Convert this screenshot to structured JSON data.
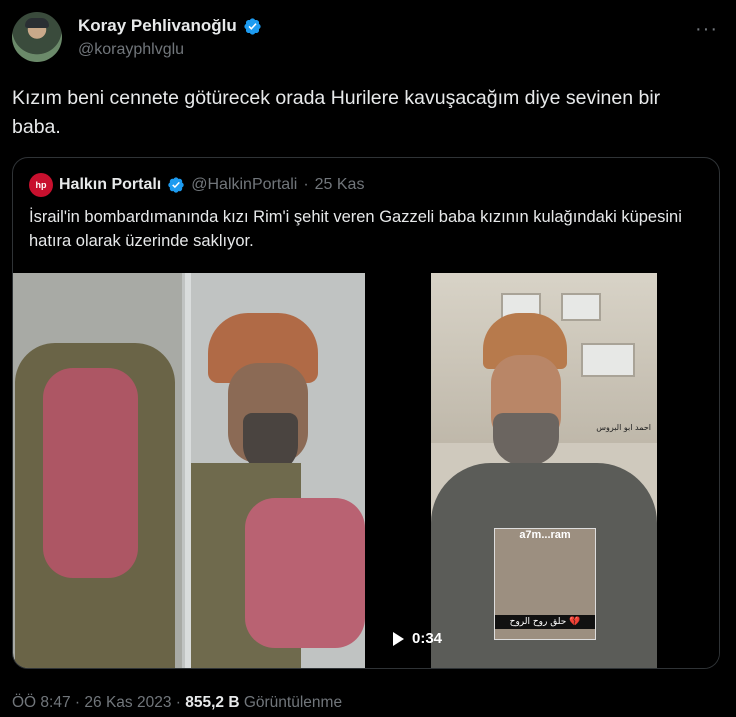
{
  "author": {
    "name": "Koray Pehlivanoğlu",
    "handle": "@korayphlvglu",
    "more_label": "···"
  },
  "tweet": {
    "text": "Kızım beni cennete götürecek orada Hurilere kavuşacağım diye sevinen bir baba."
  },
  "quote": {
    "logo_text": "hp",
    "name": "Halkın Portalı",
    "handle": "@HalkinPortali",
    "separator": "·",
    "date": "25 Kas",
    "text": "İsrail'in bombardımanında kızı Rim'i şehit veren Gazzeli baba kızının kulağındaki küpesini hatıra olarak üzerinde saklıyor.",
    "media": {
      "video_duration": "0:34",
      "overlay_arabic": "احمد ابو البروس",
      "inset_label": "a7m...ram",
      "inset_caption": "حلق روح الروح 💔"
    }
  },
  "meta": {
    "time": "ÖÖ 8:47",
    "dot": "·",
    "date": "26 Kas 2023",
    "views_count": "855,2 B",
    "views_label": "Görüntülenme"
  },
  "colors": {
    "background": "#000000",
    "text": "#e7e9ea",
    "muted": "#71767b",
    "verified": "#1d9bf0",
    "border": "#2f3336"
  }
}
